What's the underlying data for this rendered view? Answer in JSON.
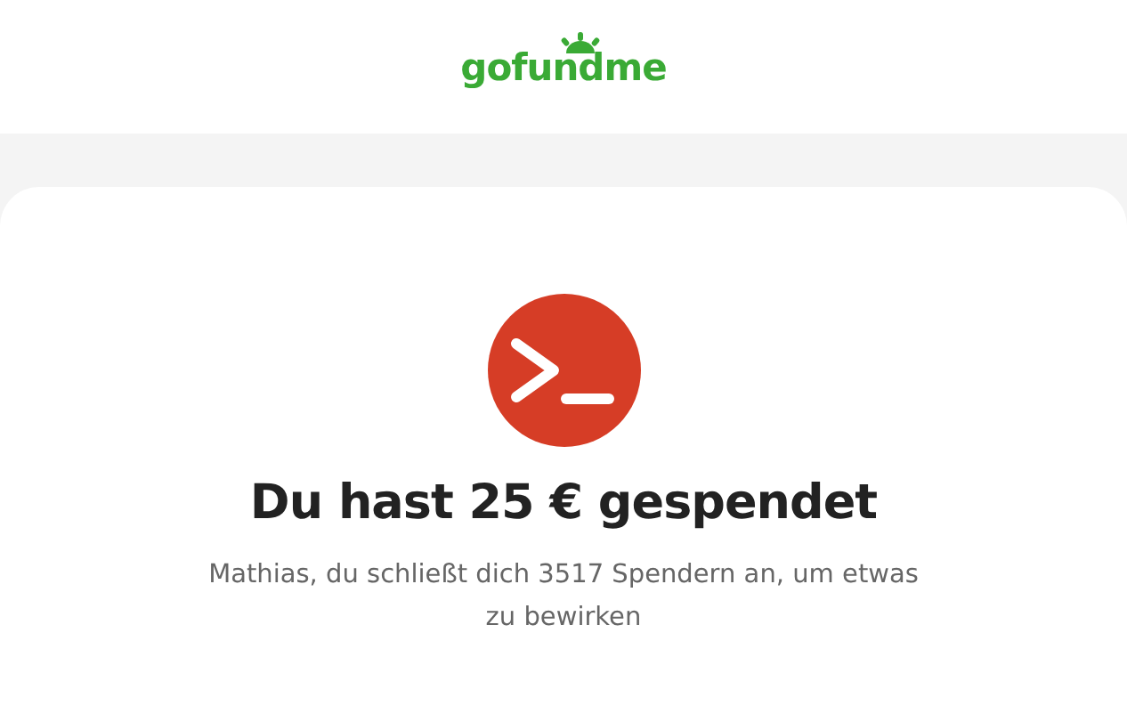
{
  "header": {
    "logo": "gofundme"
  },
  "confirmation": {
    "title": "Du hast 25 € gespendet",
    "message": "Mathias, du schließt dich 3517 Spendern an, um etwas zu bewirken"
  }
}
